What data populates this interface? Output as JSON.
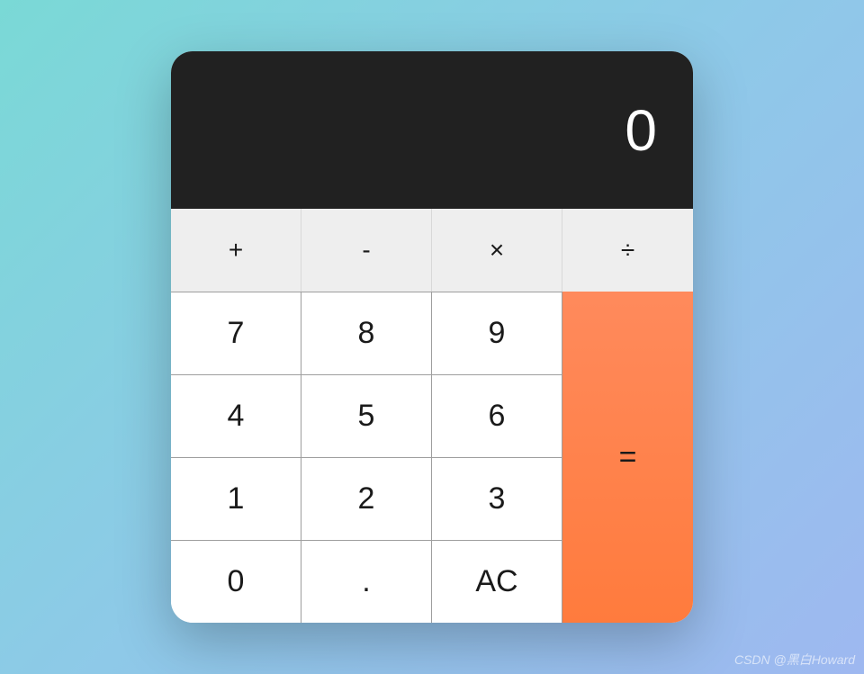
{
  "display": {
    "value": "0"
  },
  "operators": {
    "add": "+",
    "subtract": "-",
    "multiply": "×",
    "divide": "÷"
  },
  "numbers": {
    "seven": "7",
    "eight": "8",
    "nine": "9",
    "four": "4",
    "five": "5",
    "six": "6",
    "one": "1",
    "two": "2",
    "three": "3",
    "zero": "0",
    "decimal": ".",
    "clear": "AC"
  },
  "equals": "=",
  "watermark": "CSDN @黑白Howard"
}
